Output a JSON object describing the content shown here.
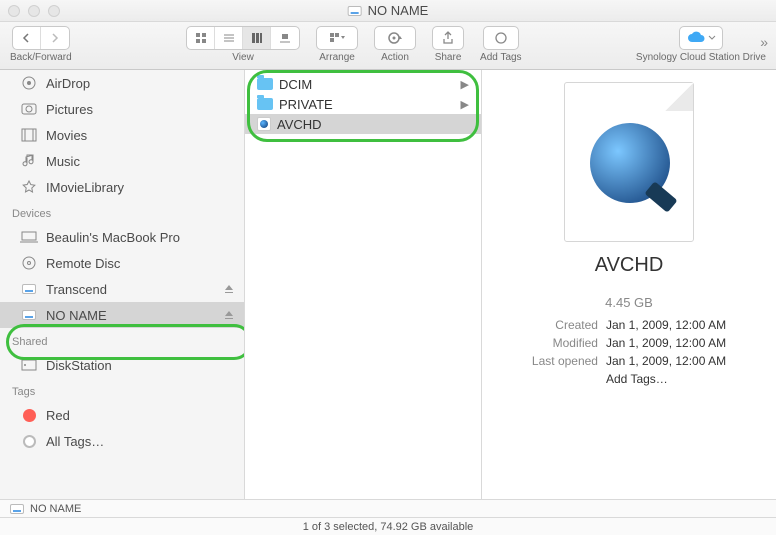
{
  "window": {
    "title": "NO NAME"
  },
  "toolbar": {
    "back_forward_label": "Back/Forward",
    "view_label": "View",
    "arrange_label": "Arrange",
    "action_label": "Action",
    "share_label": "Share",
    "add_tags_label": "Add Tags",
    "cloud_label": "Synology Cloud Station Drive"
  },
  "sidebar": {
    "top": [
      {
        "label": "AirDrop"
      },
      {
        "label": "Pictures"
      },
      {
        "label": "Movies"
      },
      {
        "label": "Music"
      },
      {
        "label": "IMovieLibrary"
      }
    ],
    "devices_header": "Devices",
    "devices": [
      {
        "label": "Beaulin's MacBook Pro",
        "ejectable": false
      },
      {
        "label": "Remote Disc",
        "ejectable": false
      },
      {
        "label": "Transcend",
        "ejectable": true
      },
      {
        "label": "NO NAME",
        "ejectable": true,
        "selected": true
      }
    ],
    "shared_header": "Shared",
    "shared": [
      {
        "label": "DiskStation"
      }
    ],
    "tags_header": "Tags",
    "tags": [
      {
        "label": "Red",
        "color": "#ff5f56"
      },
      {
        "label": "All Tags…"
      }
    ]
  },
  "column": {
    "items": [
      {
        "label": "DCIM",
        "type": "folder"
      },
      {
        "label": "PRIVATE",
        "type": "folder"
      },
      {
        "label": "AVCHD",
        "type": "quicktime",
        "selected": true
      }
    ]
  },
  "preview": {
    "name": "AVCHD",
    "size": "4.45 GB",
    "created_label": "Created",
    "created_value": "Jan 1, 2009, 12:00 AM",
    "modified_label": "Modified",
    "modified_value": "Jan 1, 2009, 12:00 AM",
    "lastopened_label": "Last opened",
    "lastopened_value": "Jan 1, 2009, 12:00 AM",
    "add_tags": "Add Tags…"
  },
  "pathbar": {
    "location": "NO NAME"
  },
  "statusbar": {
    "text": "1 of 3 selected, 74.92 GB available"
  }
}
